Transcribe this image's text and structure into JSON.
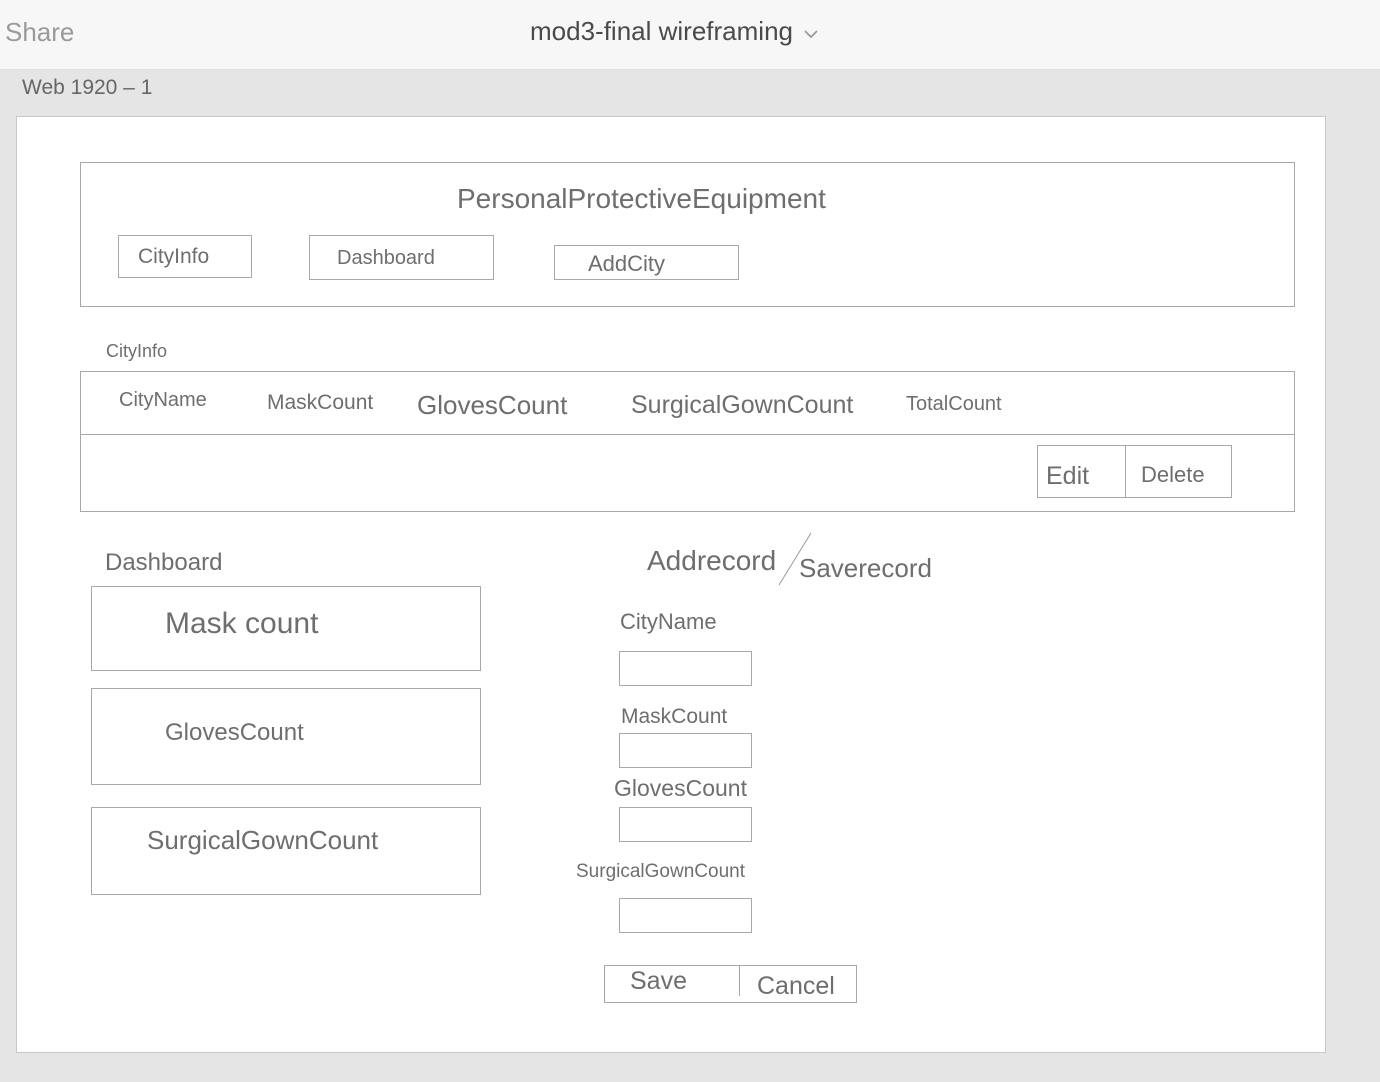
{
  "toolbar": {
    "share_label": "Share",
    "document_title": "mod3-final wireframing"
  },
  "artboard": {
    "name": "Web 1920 – 1"
  },
  "header": {
    "title": "PersonalProtectiveEquipment",
    "nav": {
      "cityinfo": "CityInfo",
      "dashboard": "Dashboard",
      "addcity": "AddCity"
    }
  },
  "cityinfo": {
    "section_label": "CityInfo",
    "columns": [
      "CityName",
      "MaskCount",
      "GlovesCount",
      "SurgicalGownCount",
      "TotalCount"
    ],
    "edit_label": "Edit",
    "delete_label": "Delete"
  },
  "dashboard": {
    "section_label": "Dashboard",
    "cards": [
      "Mask count",
      "GlovesCount",
      "SurgicalGownCount"
    ]
  },
  "form": {
    "title_add": "Addrecord",
    "title_save": "Saverecord",
    "fields": [
      "CityName",
      "MaskCount",
      "GlovesCount",
      "SurgicalGownCount"
    ],
    "save_label": "Save",
    "cancel_label": "Cancel"
  }
}
